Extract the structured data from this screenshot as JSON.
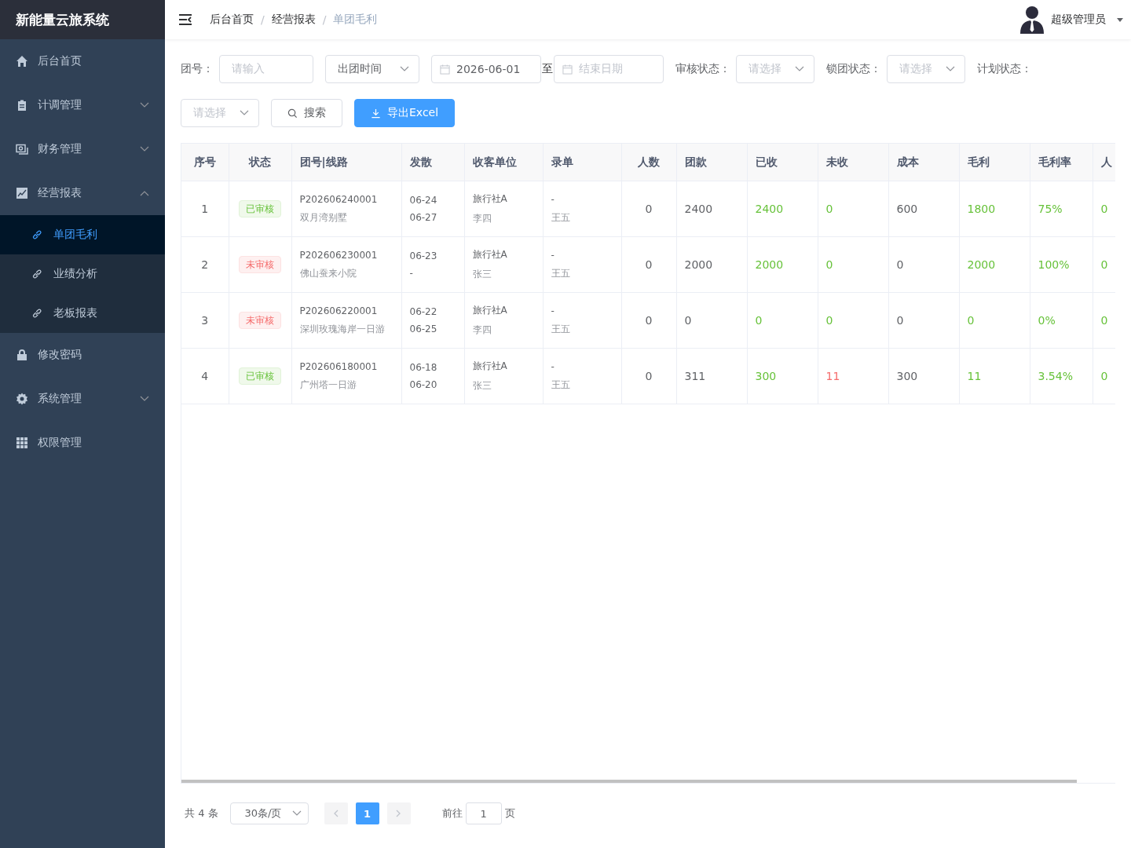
{
  "app": {
    "title": "新能量云旅系统"
  },
  "sidebar": {
    "items": [
      {
        "kind": "link",
        "label": "后台首页"
      },
      {
        "kind": "group",
        "label": "计调管理",
        "expanded": false
      },
      {
        "kind": "group",
        "label": "财务管理",
        "expanded": false
      },
      {
        "kind": "group",
        "label": "经营报表",
        "expanded": true,
        "children": [
          {
            "label": "单团毛利",
            "selected": true
          },
          {
            "label": "业绩分析",
            "selected": false
          },
          {
            "label": "老板报表",
            "selected": false
          }
        ]
      },
      {
        "kind": "link",
        "label": "修改密码"
      },
      {
        "kind": "group",
        "label": "系统管理",
        "expanded": false
      },
      {
        "kind": "link",
        "label": "权限管理"
      }
    ]
  },
  "header": {
    "separators": [
      "/",
      "/"
    ],
    "breadcrumb": [
      {
        "label": "后台首页",
        "current": false
      },
      {
        "label": "经营报表",
        "current": false
      },
      {
        "label": "单团毛利",
        "current": true
      }
    ],
    "user": "超级管理员"
  },
  "filters": [
    {
      "kind": "label",
      "text": "团号："
    },
    {
      "kind": "text",
      "placeholder": "请输入"
    },
    {
      "kind": "select",
      "value": "出团时间"
    },
    {
      "kind": "date",
      "value": "2026-06-01"
    },
    {
      "kind": "sep",
      "text": "至"
    },
    {
      "kind": "date",
      "placeholder": "结束日期"
    },
    {
      "kind": "label",
      "text": "审核状态："
    },
    {
      "kind": "select",
      "placeholder": "请选择"
    },
    {
      "kind": "label",
      "text": "锁团状态："
    },
    {
      "kind": "select",
      "placeholder": "请选择"
    },
    {
      "kind": "label",
      "text": "计划状态："
    },
    {
      "kind": "select",
      "placeholder": "请选择"
    },
    {
      "kind": "button",
      "text": "搜索"
    },
    {
      "kind": "primary",
      "text": "导出Excel"
    }
  ],
  "table": {
    "columns": [
      "序号",
      "状态",
      "团号|线路",
      "发散",
      "收客单位",
      "录单",
      "人数",
      "团款",
      "已收",
      "未收",
      "成本",
      "毛利",
      "毛利率",
      "人"
    ],
    "rows": [
      {
        "index": "1",
        "status": {
          "label": "已审核",
          "approved": true
        },
        "group_no": "P202606240001",
        "route": "双月湾别墅",
        "depart": "06-24",
        "return": "06-27",
        "agency": "旅行社A",
        "contact": "李四",
        "entry": "-",
        "entry_by": "王五",
        "figures": [
          {
            "text": "0",
            "color": "#606266"
          },
          {
            "text": "2400",
            "color": "#606266"
          },
          {
            "text": "2400",
            "color": "#67c23a"
          },
          {
            "text": "0",
            "color": "#67c23a"
          },
          {
            "text": "600",
            "color": "#606266"
          },
          {
            "text": "1800",
            "color": "#67c23a"
          },
          {
            "text": "75%",
            "color": "#67c23a"
          },
          {
            "text": "0",
            "color": "#67c23a"
          }
        ]
      },
      {
        "index": "2",
        "status": {
          "label": "未审核",
          "approved": false
        },
        "group_no": "P202606230001",
        "route": "佛山蚕来小院",
        "depart": "06-23",
        "return": "-",
        "agency": "旅行社A",
        "contact": "张三",
        "entry": "-",
        "entry_by": "王五",
        "figures": [
          {
            "text": "0",
            "color": "#606266"
          },
          {
            "text": "2000",
            "color": "#606266"
          },
          {
            "text": "2000",
            "color": "#67c23a"
          },
          {
            "text": "0",
            "color": "#67c23a"
          },
          {
            "text": "0",
            "color": "#606266"
          },
          {
            "text": "2000",
            "color": "#67c23a"
          },
          {
            "text": "100%",
            "color": "#67c23a"
          },
          {
            "text": "0",
            "color": "#67c23a"
          }
        ]
      },
      {
        "index": "3",
        "status": {
          "label": "未审核",
          "approved": false
        },
        "group_no": "P202606220001",
        "route": "深圳玫瑰海岸一日游",
        "depart": "06-22",
        "return": "06-25",
        "agency": "旅行社A",
        "contact": "李四",
        "entry": "-",
        "entry_by": "王五",
        "figures": [
          {
            "text": "0",
            "color": "#606266"
          },
          {
            "text": "0",
            "color": "#606266"
          },
          {
            "text": "0",
            "color": "#67c23a"
          },
          {
            "text": "0",
            "color": "#67c23a"
          },
          {
            "text": "0",
            "color": "#606266"
          },
          {
            "text": "0",
            "color": "#67c23a"
          },
          {
            "text": "0%",
            "color": "#67c23a"
          },
          {
            "text": "0",
            "color": "#67c23a"
          }
        ]
      },
      {
        "index": "4",
        "status": {
          "label": "已审核",
          "approved": true
        },
        "group_no": "P202606180001",
        "route": "广州塔一日游",
        "depart": "06-18",
        "return": "06-20",
        "agency": "旅行社A",
        "contact": "张三",
        "entry": "-",
        "entry_by": "王五",
        "figures": [
          {
            "text": "0",
            "color": "#606266"
          },
          {
            "text": "311",
            "color": "#606266"
          },
          {
            "text": "300",
            "color": "#67c23a"
          },
          {
            "text": "11",
            "color": "#f56c6c"
          },
          {
            "text": "300",
            "color": "#606266"
          },
          {
            "text": "11",
            "color": "#67c23a"
          },
          {
            "text": "3.54%",
            "color": "#67c23a"
          },
          {
            "text": "0",
            "color": "#67c23a"
          }
        ]
      }
    ]
  },
  "pagination": {
    "total": "共 4 条",
    "page_size": "30条/页",
    "pages": [
      {
        "label": "1",
        "selected": true
      }
    ],
    "goto": "前往",
    "goto_value": "1",
    "page_unit": "页"
  }
}
